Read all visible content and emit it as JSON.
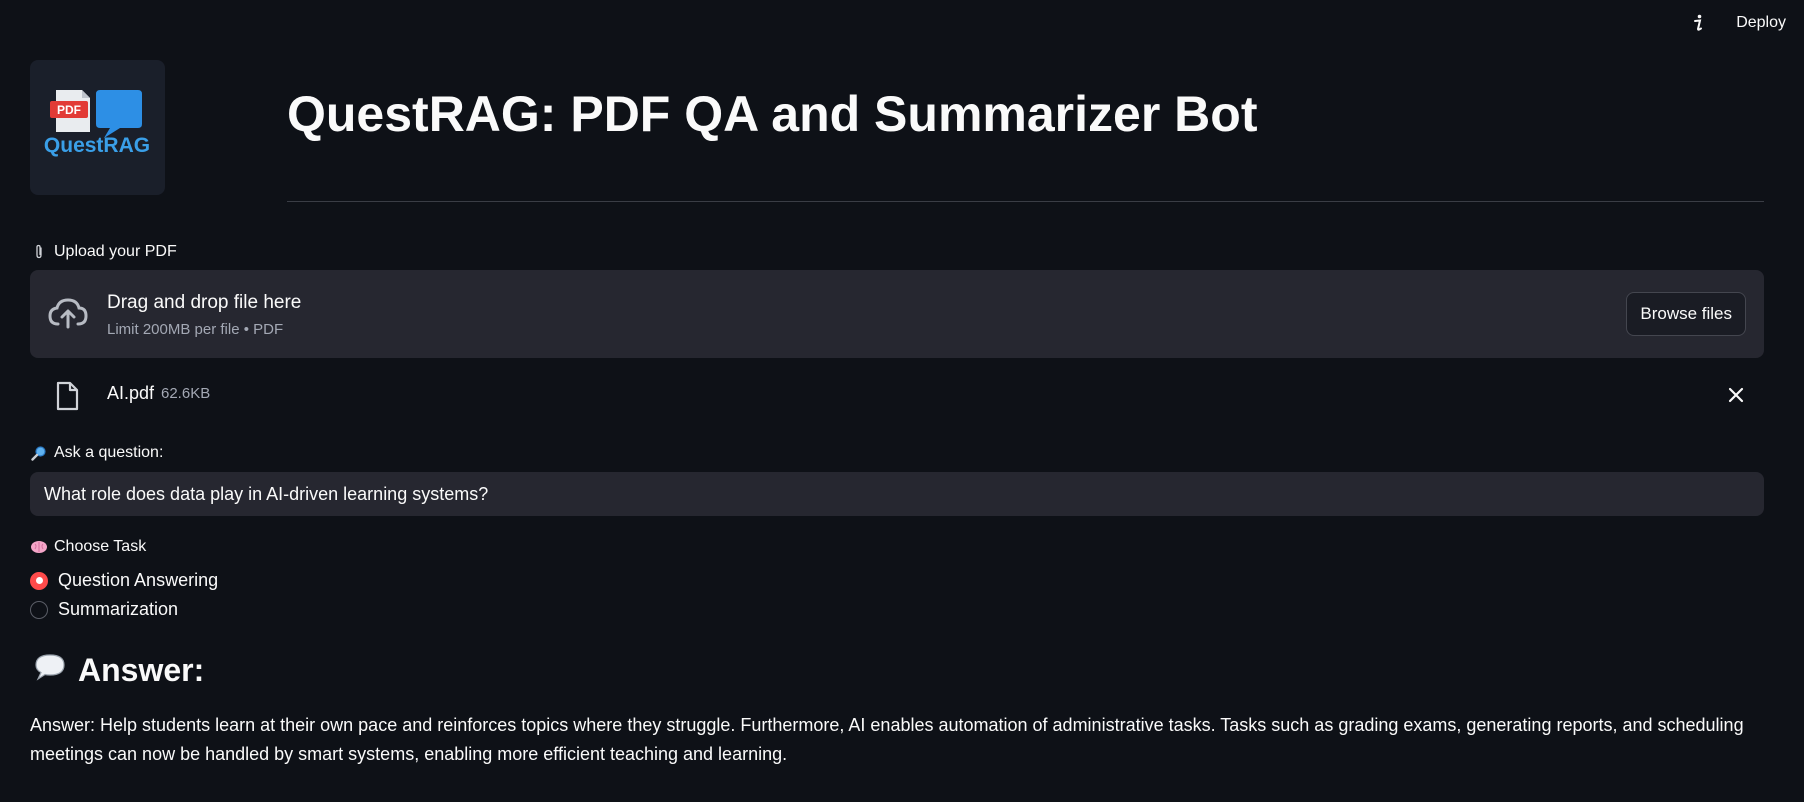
{
  "header": {
    "deploy_label": "Deploy",
    "info_icon": "info-icon"
  },
  "logo": {
    "badge_text": "PDF",
    "brand_text": "QuestRAG"
  },
  "page_title": "QuestRAG: PDF QA and Summarizer Bot",
  "uploader": {
    "label": "Upload your PDF",
    "label_icon": "paperclip-icon",
    "drop_title": "Drag and drop file here",
    "drop_subtitle": "Limit 200MB per file • PDF",
    "browse_label": "Browse files",
    "file": {
      "name": "AI.pdf",
      "size": "62.6KB"
    }
  },
  "question": {
    "label": "Ask a question:",
    "label_icon": "magnifier-icon",
    "value": "What role does data play in AI-driven learning systems?"
  },
  "task": {
    "label": "Choose Task",
    "label_icon": "brain-icon",
    "options": [
      {
        "label": "Question Answering",
        "selected": true
      },
      {
        "label": "Summarization",
        "selected": false
      }
    ]
  },
  "answer": {
    "heading": "Answer:",
    "heading_icon": "speech-bubble-icon",
    "text": "Answer: Help students learn at their own pace and reinforces topics where they struggle. Furthermore, AI enables automation of administrative tasks. Tasks such as grading exams, generating reports, and scheduling meetings can now be handled by smart systems, enabling more efficient teaching and learning."
  },
  "colors": {
    "background": "#0e1117",
    "surface": "#262730",
    "accent": "#ff4b4b",
    "text": "#fafafa",
    "muted_text": "#a3a8b4"
  }
}
